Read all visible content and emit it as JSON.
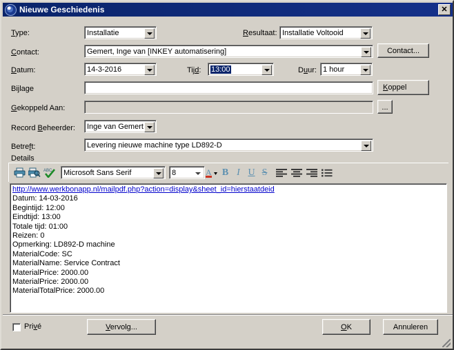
{
  "window": {
    "title": "Nieuwe Geschiedenis",
    "icon": "globe-icon",
    "close_label": "✕"
  },
  "form": {
    "type_label": "Type:",
    "type_value": "Installatie",
    "resultaat_label": "Resultaat:",
    "resultaat_value": "Installatie Voltooid",
    "contact_label": "Contact:",
    "contact_value": "Gemert, Inge van [INKEY automatisering]",
    "contact_button": "Contact...",
    "datum_label": "Datum:",
    "datum_value": "14-3-2016",
    "tijd_label": "Tijd:",
    "tijd_value": "13:00",
    "duur_label": "Duur:",
    "duur_value": "1 hour",
    "bijlage_label": "Bijlage",
    "bijlage_value": "",
    "koppel_button": "Koppel",
    "gekoppeld_label": "Gekoppeld Aan:",
    "gekoppeld_value": "",
    "ellipsis_button": "...",
    "beheerder_label": "Record Beheerder:",
    "beheerder_value": "Inge van Gemert",
    "betreft_label": "Betreft:",
    "betreft_value": "Levering nieuwe machine type LD892-D",
    "details_label": "Details"
  },
  "toolbar": {
    "print_icon": "print-icon",
    "print_preview_icon": "print-preview-icon",
    "spellcheck_icon": "spellcheck-icon",
    "font_name": "Microsoft Sans Serif",
    "font_size": "8",
    "font_color_label": "A",
    "bold_label": "B",
    "italic_label": "I",
    "underline_label": "U",
    "strike_label": "S",
    "align_left_icon": "align-left-icon",
    "align_center_icon": "align-center-icon",
    "align_right_icon": "align-right-icon",
    "bullets_icon": "bullet-list-icon"
  },
  "editor": {
    "link": "http://www.werkbonapp.nl/mailpdf.php?action=display&sheet_id=hierstaatdeid",
    "lines": [
      "Datum: 14-03-2016",
      "Begintijd: 12:00",
      "Eindtijd: 13:00",
      "Totale tijd: 01:00",
      "Reizen: 0",
      "Opmerking: LD892-D machine",
      "MaterialCode: SC",
      "MaterialName: Service Contract",
      "MaterialPrice: 2000.00",
      "MaterialPrice: 2000.00",
      "MaterialTotalPrice: 2000.00"
    ]
  },
  "footer": {
    "prive_label": "Privé",
    "vervolg_button": "Vervolg...",
    "ok_button": "OK",
    "cancel_button": "Annuleren"
  },
  "colors": {
    "titlebar": "#0a246a",
    "face": "#d4d0c8",
    "selection": "#0a246a",
    "link": "#0000cc"
  }
}
